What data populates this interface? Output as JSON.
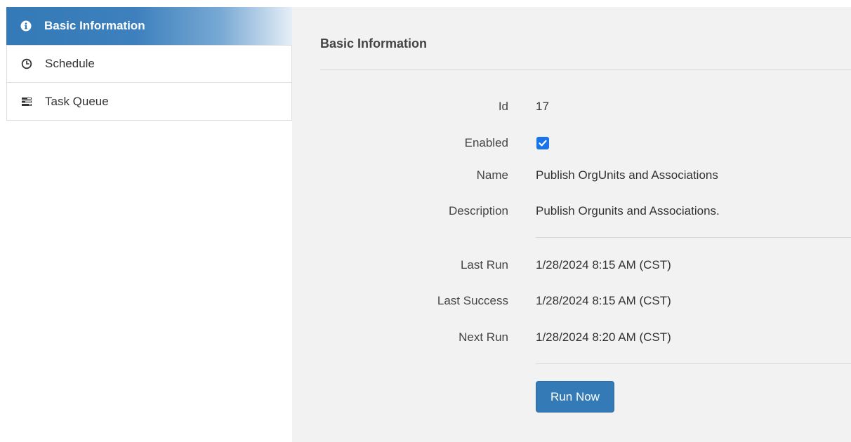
{
  "sidebar": {
    "items": [
      {
        "label": "Basic Information",
        "icon": "info-circle-icon",
        "active": true
      },
      {
        "label": "Schedule",
        "icon": "clock-icon",
        "active": false
      },
      {
        "label": "Task Queue",
        "icon": "tasks-icon",
        "active": false
      }
    ]
  },
  "panel": {
    "title": "Basic Information",
    "fields": {
      "id": {
        "label": "Id",
        "value": "17"
      },
      "enabled": {
        "label": "Enabled",
        "checked": true
      },
      "name": {
        "label": "Name",
        "value": "Publish OrgUnits and Associations"
      },
      "description": {
        "label": "Description",
        "value": "Publish Orgunits and Associations."
      },
      "last_run": {
        "label": "Last Run",
        "value": "1/28/2024 8:15 AM (CST)"
      },
      "last_success": {
        "label": "Last Success",
        "value": "1/28/2024 8:15 AM (CST)"
      },
      "next_run": {
        "label": "Next Run",
        "value": "1/28/2024 8:20 AM (CST)"
      }
    },
    "run_button_label": "Run Now"
  },
  "colors": {
    "primary": "#337ab7",
    "checkbox": "#1a73e8",
    "panel_bg": "#f2f2f2"
  }
}
